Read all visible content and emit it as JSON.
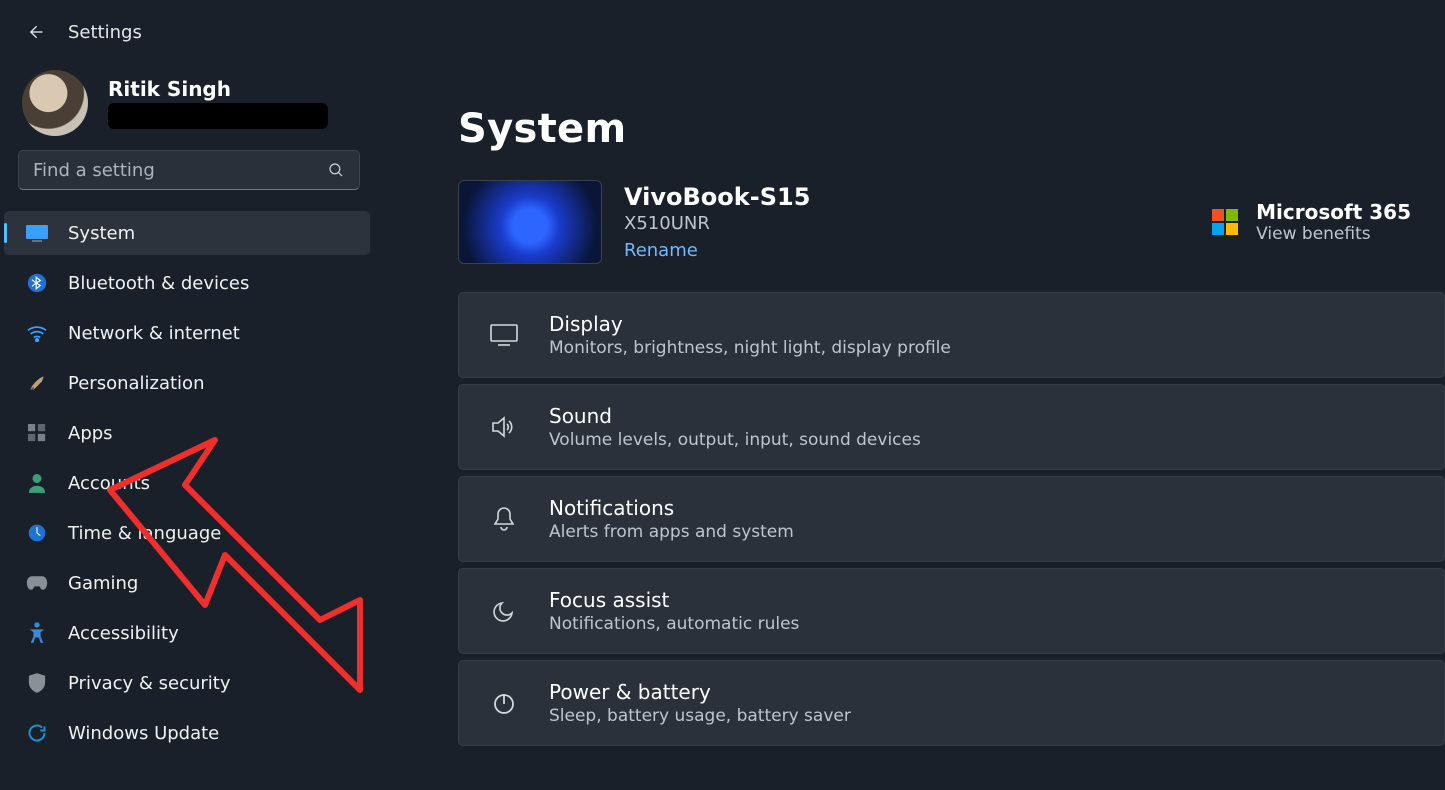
{
  "app_title": "Settings",
  "profile": {
    "name": "Ritik Singh"
  },
  "search": {
    "placeholder": "Find a setting"
  },
  "sidebar": {
    "items": [
      {
        "label": "System"
      },
      {
        "label": "Bluetooth & devices"
      },
      {
        "label": "Network & internet"
      },
      {
        "label": "Personalization"
      },
      {
        "label": "Apps"
      },
      {
        "label": "Accounts"
      },
      {
        "label": "Time & language"
      },
      {
        "label": "Gaming"
      },
      {
        "label": "Accessibility"
      },
      {
        "label": "Privacy & security"
      },
      {
        "label": "Windows Update"
      }
    ]
  },
  "page": {
    "title": "System",
    "device": {
      "name": "VivoBook-S15",
      "model": "X510UNR",
      "rename": "Rename"
    },
    "ms365": {
      "title": "Microsoft 365",
      "sub": "View benefits"
    },
    "cards": [
      {
        "title": "Display",
        "sub": "Monitors, brightness, night light, display profile"
      },
      {
        "title": "Sound",
        "sub": "Volume levels, output, input, sound devices"
      },
      {
        "title": "Notifications",
        "sub": "Alerts from apps and system"
      },
      {
        "title": "Focus assist",
        "sub": "Notifications, automatic rules"
      },
      {
        "title": "Power & battery",
        "sub": "Sleep, battery usage, battery saver"
      }
    ]
  }
}
